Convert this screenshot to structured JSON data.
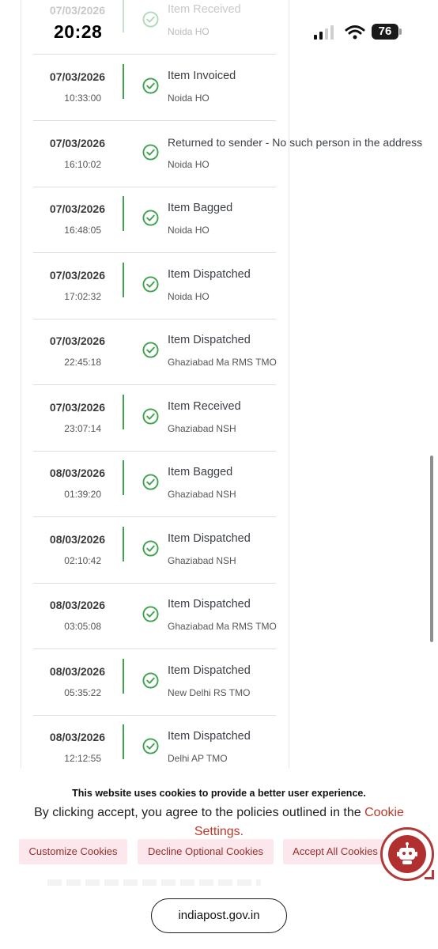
{
  "status_bar": {
    "time": "20:28",
    "battery": "76"
  },
  "tracking_events": [
    {
      "date": "07/03/2026",
      "time": "",
      "status": "Item Received",
      "office": "Noida HO"
    },
    {
      "date": "07/03/2026",
      "time": "10:33:00",
      "status": "Item Invoiced",
      "office": "Noida HO"
    },
    {
      "date": "07/03/2026",
      "time": "16:10:02",
      "status": "Returned to sender - No such person in the address",
      "office": "Noida HO"
    },
    {
      "date": "07/03/2026",
      "time": "16:48:05",
      "status": "Item Bagged",
      "office": "Noida HO"
    },
    {
      "date": "07/03/2026",
      "time": "17:02:32",
      "status": "Item Dispatched",
      "office": "Noida HO"
    },
    {
      "date": "07/03/2026",
      "time": "22:45:18",
      "status": "Item Dispatched",
      "office": "Ghaziabad Ma RMS TMO"
    },
    {
      "date": "07/03/2026",
      "time": "23:07:14",
      "status": "Item Received",
      "office": "Ghaziabad NSH"
    },
    {
      "date": "08/03/2026",
      "time": "01:39:20",
      "status": "Item Bagged",
      "office": "Ghaziabad NSH"
    },
    {
      "date": "08/03/2026",
      "time": "02:10:42",
      "status": "Item Dispatched",
      "office": "Ghaziabad NSH"
    },
    {
      "date": "08/03/2026",
      "time": "03:05:08",
      "status": "Item Dispatched",
      "office": "Ghaziabad Ma RMS TMO"
    },
    {
      "date": "08/03/2026",
      "time": "05:35:22",
      "status": "Item Dispatched",
      "office": "New Delhi RS TMO"
    },
    {
      "date": "08/03/2026",
      "time": "12:12:55",
      "status": "Item Dispatched",
      "office": "Delhi AP TMO"
    }
  ],
  "cookie_banner": {
    "title": "This website uses cookies to provide a better user experience.",
    "text": "By clicking accept, you agree to the policies outlined in the ",
    "link": "Cookie Settings.",
    "customize": "Customize Cookies",
    "decline": "Decline Optional Cookies",
    "accept": "Accept All Cookies"
  },
  "url_bar": {
    "url": "indiapost.gov.in"
  },
  "colors": {
    "check_green": "#3fa34d",
    "brand_red": "#b22f2f",
    "button_bg": "#fce8ec"
  },
  "icons": {
    "check": "check-circle-icon",
    "chatbot": "chatbot-icon",
    "signal": "signal-icon",
    "wifi": "wifi-icon"
  }
}
